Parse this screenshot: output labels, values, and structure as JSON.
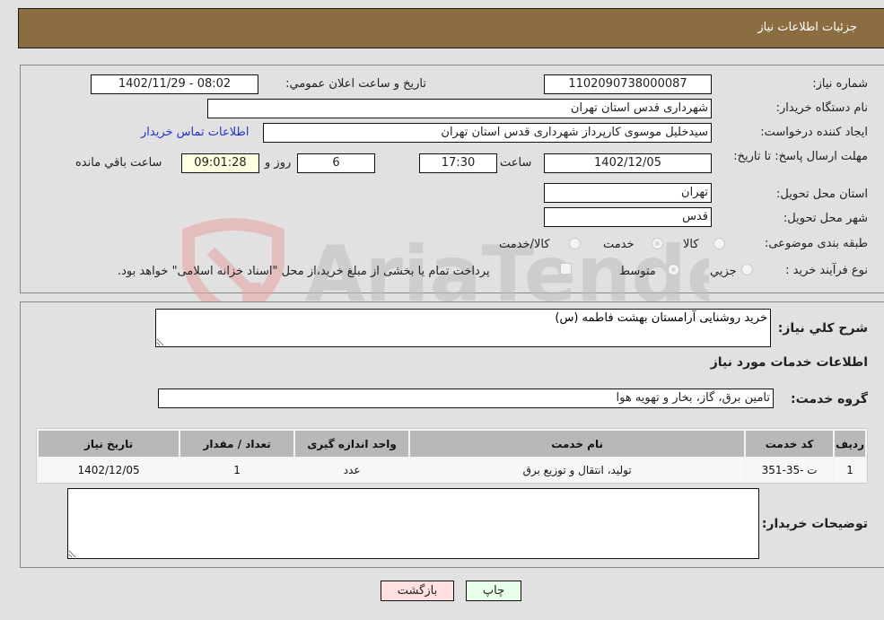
{
  "header": {
    "title": "جزئیات اطلاعات نیاز"
  },
  "fields": {
    "need_number": {
      "label": "شماره نیاز:",
      "value": "1102090738000087"
    },
    "announce_datetime": {
      "label": "تاریخ و ساعت اعلان عمومي:",
      "value": "1402/11/29 - 08:02"
    },
    "buyer_org": {
      "label": "نام دستگاه خریدار:",
      "value": "شهرداری قدس استان تهران"
    },
    "requester": {
      "label": "ایجاد کننده درخواست:",
      "value": "سیدخلیل موسوی کارپرداز شهرداری قدس استان تهران"
    },
    "buyer_contact_link": "اطلاعات تماس خریدار",
    "deadline": {
      "label": "مهلت ارسال پاسخ: تا تاریخ:",
      "date": "1402/12/05",
      "time_label": "ساعت",
      "time": "17:30",
      "days": "6",
      "days_label": "روز و",
      "remaining": "09:01:28",
      "remaining_label": "ساعت باقي مانده"
    },
    "delivery_province": {
      "label": "استان محل تحویل:",
      "value": "تهران"
    },
    "delivery_city": {
      "label": "شهر محل تحویل:",
      "value": "قدس"
    },
    "category": {
      "label": "طبقه بندی موضوعی:",
      "options": [
        "کالا",
        "خدمت",
        "کالا/خدمت"
      ],
      "selected": "خدمت"
    },
    "purchase_process": {
      "label": "نوع فرآیند خرید :",
      "options": [
        "جزیي",
        "متوسط"
      ],
      "selected": "متوسط",
      "treasury_note": "پرداخت تمام یا بخشی از مبلغ خرید،از محل \"اسناد خزانه اسلامی\" خواهد بود."
    }
  },
  "description": {
    "label": "شرح کلي نیاز:",
    "value": "خرید روشنایی آرامستان بهشت فاطمه (س)"
  },
  "services_section_title": "اطلاعات خدمات مورد نیاز",
  "service_group": {
    "label": "گروه خدمت:",
    "value": "تامین برق، گاز، بخار و تهویه هوا"
  },
  "services_table": {
    "headers": [
      "ردیف",
      "کد خدمت",
      "نام خدمت",
      "واحد اندازه گیری",
      "تعداد / مقدار",
      "تاریخ نیاز"
    ],
    "rows": [
      [
        "1",
        "ت -35-351",
        "تولید، انتقال و توزیع برق",
        "عدد",
        "1",
        "1402/12/05"
      ]
    ]
  },
  "buyer_notes": {
    "label": "توضیحات خریدار:",
    "value": ""
  },
  "buttons": {
    "print": "چاپ",
    "back": "بازگشت"
  },
  "watermark_text": "AriaTender.neT"
}
